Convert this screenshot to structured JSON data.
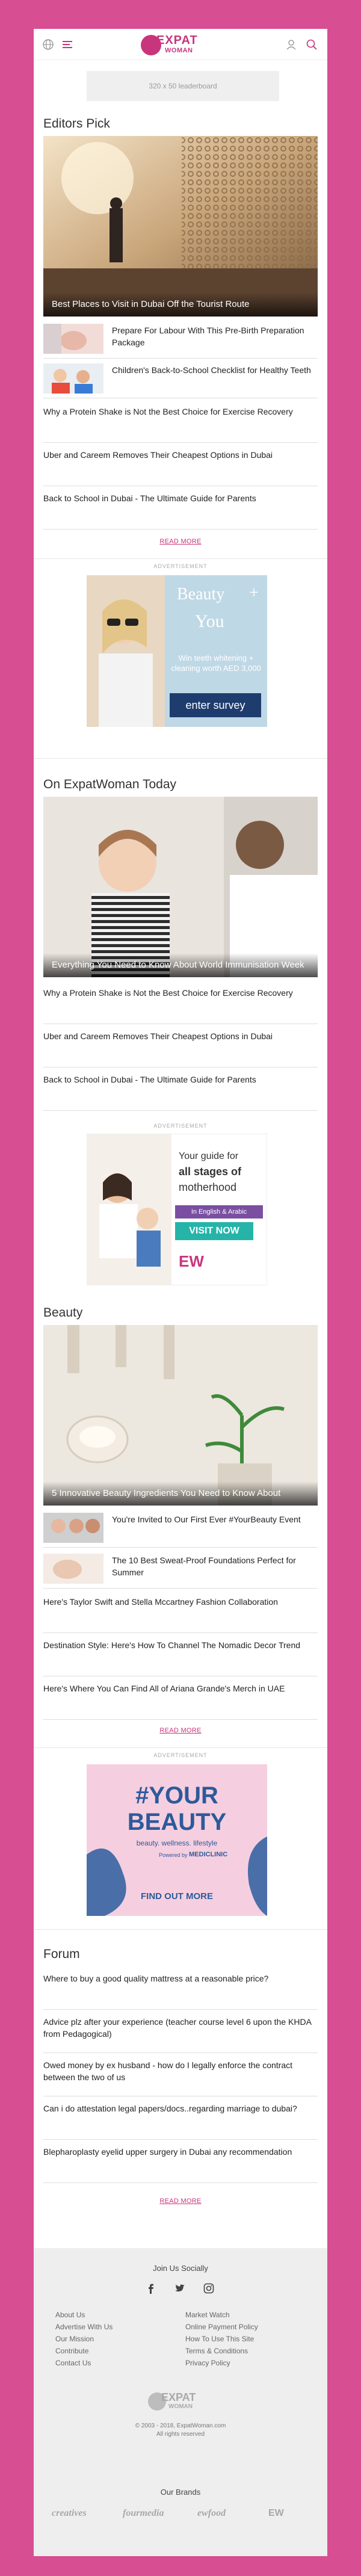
{
  "header": {
    "logo_line1": "EXPAT",
    "logo_line2": "WOMAN"
  },
  "leaderboard_label": "320 x 50 leaderboard",
  "editors_pick": {
    "title": "Editors Pick",
    "hero_caption": "Best Places to Visit in Dubai Off the Tourist Route",
    "thumb_items": [
      "Prepare For Labour With This Pre-Birth Preparation Package",
      "Children's Back-to-School Checklist for Healthy Teeth"
    ],
    "text_items": [
      "Why a Protein Shake is Not the Best Choice for Exercise Recovery",
      "Uber and Careem Removes Their Cheapest Options in Dubai",
      "Back to School in Dubai - The Ultimate Guide for Parents"
    ],
    "read_more": "READ MORE"
  },
  "ad1": {
    "label": "ADVERTISEMENT",
    "headline_1": "Beauty",
    "plus": "+",
    "headline_2": "You",
    "body": "Win teeth whitening + cleaning worth AED 3,000",
    "cta": "enter survey"
  },
  "today": {
    "title": "On ExpatWoman Today",
    "hero_caption": "Everything You Need to Know About World Immunisation Week",
    "text_items": [
      "Why a Protein Shake is Not the Best Choice for Exercise Recovery",
      "Uber and Careem Removes Their Cheapest Options in Dubai",
      "Back to School in Dubai - The Ultimate Guide for Parents"
    ]
  },
  "ad2": {
    "label": "ADVERTISEMENT",
    "line1": "Your guide for",
    "line2": "all stages of",
    "line3": "motherhood",
    "lang": "In English & Arabic",
    "cta": "VISIT NOW",
    "brand": "EW"
  },
  "beauty": {
    "title": "Beauty",
    "hero_caption": "5 Innovative Beauty Ingredients You Need to Know About",
    "thumb_items": [
      "You're Invited to Our First Ever #YourBeauty Event",
      "The 10 Best Sweat-Proof Foundations Perfect for Summer"
    ],
    "text_items": [
      "Here's Taylor Swift and Stella Mccartney Fashion Collaboration",
      "Destination Style: Here's How To Channel The Nomadic Decor Trend",
      "Here's Where You Can Find All of Ariana Grande's Merch in UAE"
    ],
    "read_more": "READ MORE"
  },
  "ad3": {
    "label": "ADVERTISEMENT",
    "line1": "#YOUR",
    "line2": "BEAUTY",
    "tagline": "beauty. wellness. lifestyle",
    "powered": "Powered by",
    "sponsor": "MEDICLINIC",
    "cta": "FIND OUT MORE"
  },
  "forum": {
    "title": "Forum",
    "items": [
      "Where to buy a good quality mattress at a reasonable price?",
      "Advice plz after your experience (teacher course level 6 upon the KHDA from Pedagogical)",
      "Owed money by ex husband - how do I legally enforce the contract between the two of us",
      "Can i do attestation legal papers/docs..regarding marriage to dubai?",
      "Blepharoplasty eyelid upper surgery in Dubai any recommendation"
    ],
    "read_more": "READ MORE"
  },
  "footer": {
    "social_title": "Join Us Socially",
    "col1": [
      "About Us",
      "Advertise With Us",
      "Our Mission",
      "Contribute",
      "Contact Us"
    ],
    "col2": [
      "Market Watch",
      "Online Payment Policy",
      "How To Use This Site",
      "Terms & Conditions",
      "Privacy Policy"
    ],
    "copyright_1": "© 2003 - 2018, ExpatWoman.com",
    "copyright_2": "All rights reserved",
    "brands_title": "Our Brands",
    "brands": [
      "creatives",
      "fourmedia",
      "ewfood",
      "EW"
    ]
  },
  "colors": {
    "brand": "#c9357d",
    "background": "#d84e93",
    "footer": "#eeeeee"
  }
}
